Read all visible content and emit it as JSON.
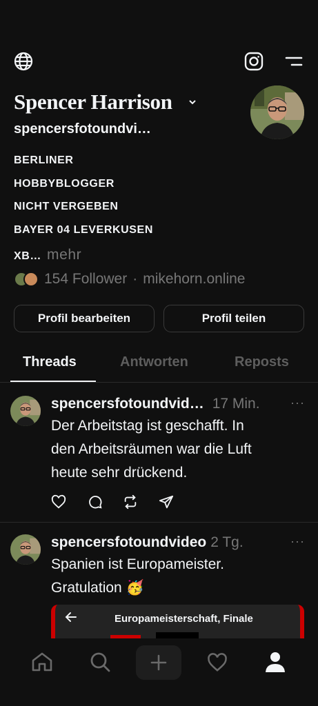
{
  "header": {
    "globe_icon": "globe-icon",
    "instagram_icon": "instagram-icon",
    "menu_icon": "menu-icon"
  },
  "profile": {
    "name": "Spencer Harrison",
    "handle": "spencersfotoundvi…",
    "bio": [
      "BERLINER",
      "HOBBYBLOGGER",
      "NICHT VERGEBEN",
      "BAYER 04 LEVERKUSEN",
      "XB…"
    ],
    "bio_more": "mehr",
    "followers": "154 Follower",
    "separator": "·",
    "website": "mikehorn.online"
  },
  "buttons": {
    "edit": "Profil bearbeiten",
    "share": "Profil teilen"
  },
  "tabs": [
    {
      "label": "Threads",
      "active": true
    },
    {
      "label": "Antworten",
      "active": false
    },
    {
      "label": "Reposts",
      "active": false
    }
  ],
  "posts": [
    {
      "user": "spencersfotoundvid…",
      "time": "17 Min.",
      "lines": [
        "Der Arbeitstag ist geschafft. In",
        "den Arbeitsräumen war die Luft",
        "heute sehr drückend."
      ],
      "more": "···"
    },
    {
      "user": "spencersfotoundvideo",
      "time": "2 Tg.",
      "lines": [
        "Spanien ist Europameister.",
        "Gratulation 🥳"
      ],
      "more": "···",
      "embed_title": "Europameisterschaft, Finale"
    }
  ],
  "colors": {
    "background": "#101010",
    "text": "#f3f5f7",
    "muted": "#777777",
    "accent_red": "#cc0000"
  }
}
